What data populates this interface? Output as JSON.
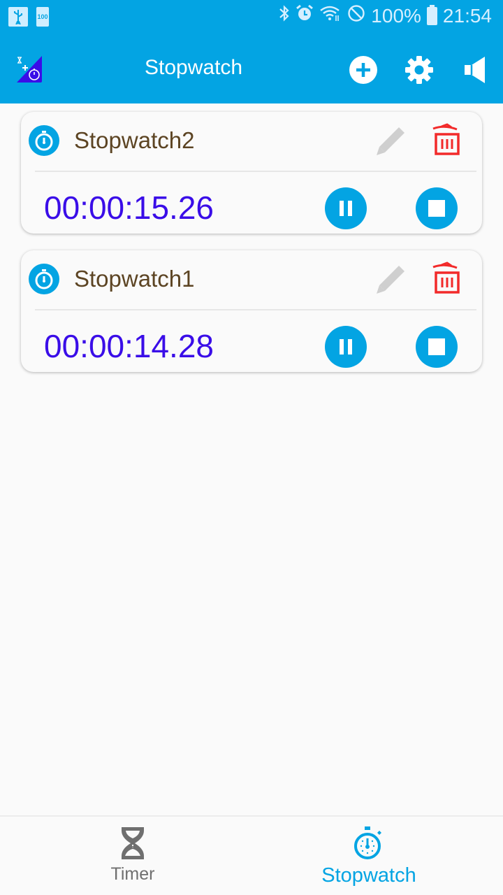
{
  "status_bar": {
    "left_icons": [
      "usb-icon",
      "battery-100-icon"
    ],
    "battery_small_label": "100",
    "right_icons": [
      "bluetooth-icon",
      "alarm-icon",
      "wifi-icon",
      "do-not-disturb-icon",
      "battery-icon"
    ],
    "battery_percent": "100%",
    "time": "21:54"
  },
  "app_bar": {
    "title": "Stopwatch",
    "actions": [
      "add-icon",
      "settings-icon",
      "volume-icon"
    ]
  },
  "stopwatches": [
    {
      "name": "Stopwatch2",
      "elapsed": "00:00:15.26",
      "state": "running"
    },
    {
      "name": "Stopwatch1",
      "elapsed": "00:00:14.28",
      "state": "running"
    }
  ],
  "bottom_nav": {
    "items": [
      {
        "label": "Timer",
        "icon": "hourglass-icon",
        "active": false
      },
      {
        "label": "Stopwatch",
        "icon": "stopwatch-icon",
        "active": true
      }
    ]
  },
  "colors": {
    "primary": "#03a4e3",
    "time_text": "#3a0de8",
    "name_text": "#5c4423",
    "delete": "#f22a2a",
    "edit_disabled": "#cfcfcf",
    "inactive_nav": "#6f6f6f"
  }
}
